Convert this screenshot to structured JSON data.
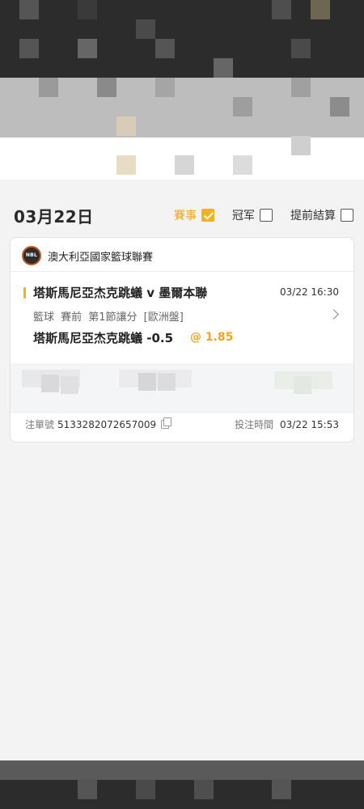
{
  "header": {
    "date": "03月22日",
    "filters": [
      {
        "label": "賽事",
        "checked": true
      },
      {
        "label": "冠军",
        "checked": false
      },
      {
        "label": "提前結算",
        "checked": false
      }
    ]
  },
  "bet": {
    "league": "澳大利亞國家籃球聯賽",
    "league_logo_text": "NBL",
    "match": "塔斯馬尼亞杰克跳蟻 v 墨爾本聯",
    "match_time": "03/22 16:30",
    "meta": "籃球 賽前 第1節讓分 [歐洲盤]",
    "selection": "塔斯馬尼亞杰克跳蟻 -0.5",
    "odds": "@ 1.85",
    "order_label": "注單號",
    "order_no": "5133282072657009",
    "placed_label": "投注時間",
    "placed_time": "03/22 15:53"
  },
  "colors": {
    "accent": "#f1b31c",
    "background": "#f3f3f3",
    "card": "#ffffff"
  }
}
